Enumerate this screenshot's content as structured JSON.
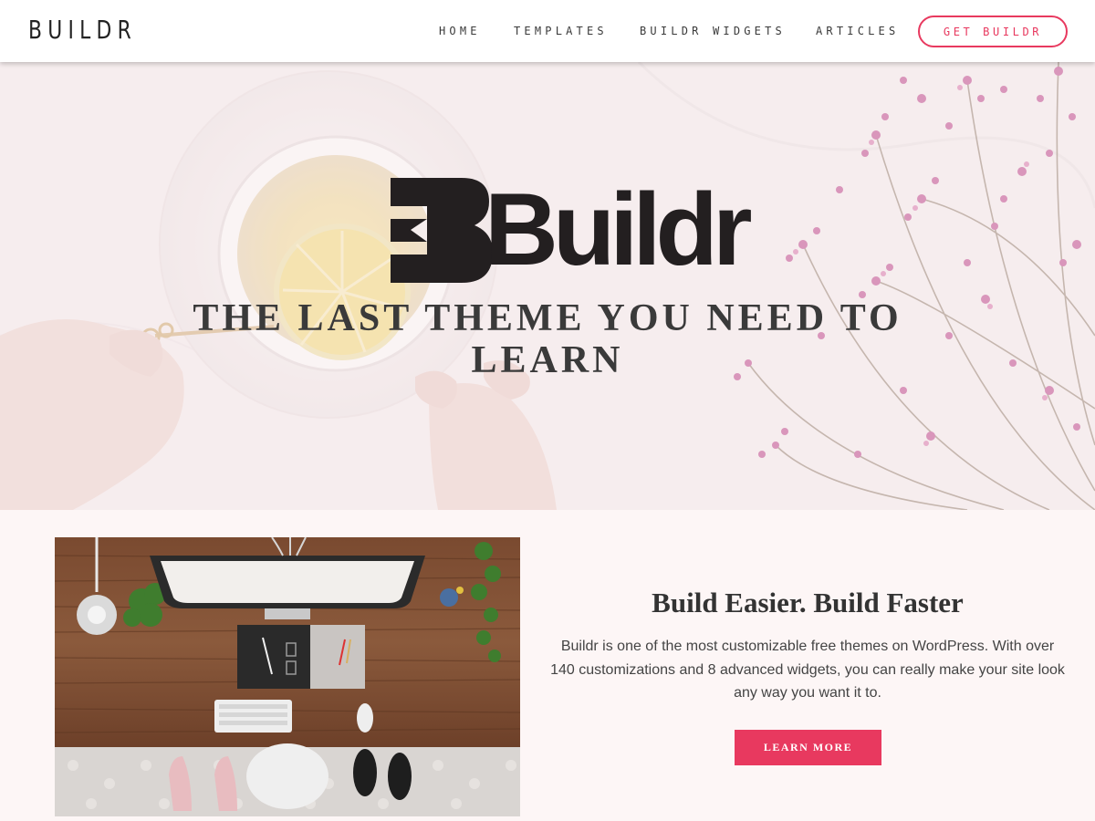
{
  "header": {
    "logo": "BUILDR",
    "nav": {
      "home": "HOME",
      "templates": "TEMPLATES",
      "builder_widgets": "BUILDR WIDGETS",
      "articles": "ARTICLES"
    },
    "cta": "GET BUILDR"
  },
  "hero": {
    "logo_wordmark": "Buildr",
    "tagline": "THE LAST THEME YOU NEED TO LEARN"
  },
  "feature": {
    "title": "Build Easier. Build Faster",
    "body": "Buildr is one of the most customizable free themes on WordPress. With over 140 customizations and 8 advanced widgets, you can really make your site look any way you want it to.",
    "button": "LEARN MORE"
  },
  "colors": {
    "accent": "#e8395f",
    "text_dark": "#333333",
    "page_bg": "#fdf6f6"
  }
}
